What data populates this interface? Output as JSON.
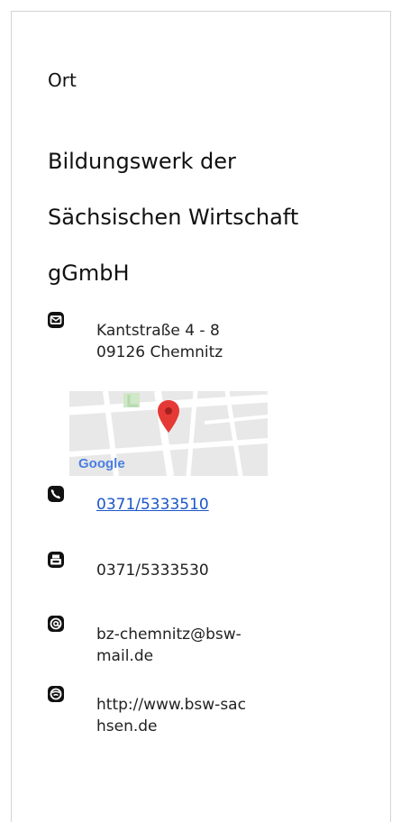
{
  "section": {
    "label": "Ort"
  },
  "organization": {
    "name_line1": "Bildungswerk der",
    "name_line2": "Sächsischen Wirtschaft",
    "name_line3": "gGmbH"
  },
  "address": {
    "street": "Kantstraße 4 - 8",
    "city": "09126 Chemnitz",
    "icon": "mail-icon"
  },
  "map": {
    "provider_label": "Google",
    "marker_color": "#e53935"
  },
  "phone": {
    "value": "0371/5333510",
    "icon": "phone-icon"
  },
  "fax": {
    "value": "0371/5333530",
    "icon": "fax-icon"
  },
  "email": {
    "line1": "bz-chemnitz@bsw-",
    "line2": "mail.de",
    "icon": "at-icon"
  },
  "website": {
    "line1": "http://www.bsw-sac",
    "line2": "hsen.de",
    "icon": "globe-icon"
  },
  "colors": {
    "text": "#111111",
    "link": "#1a56c8",
    "border": "#d4d4d4",
    "map_bg": "#e6e6e6"
  }
}
